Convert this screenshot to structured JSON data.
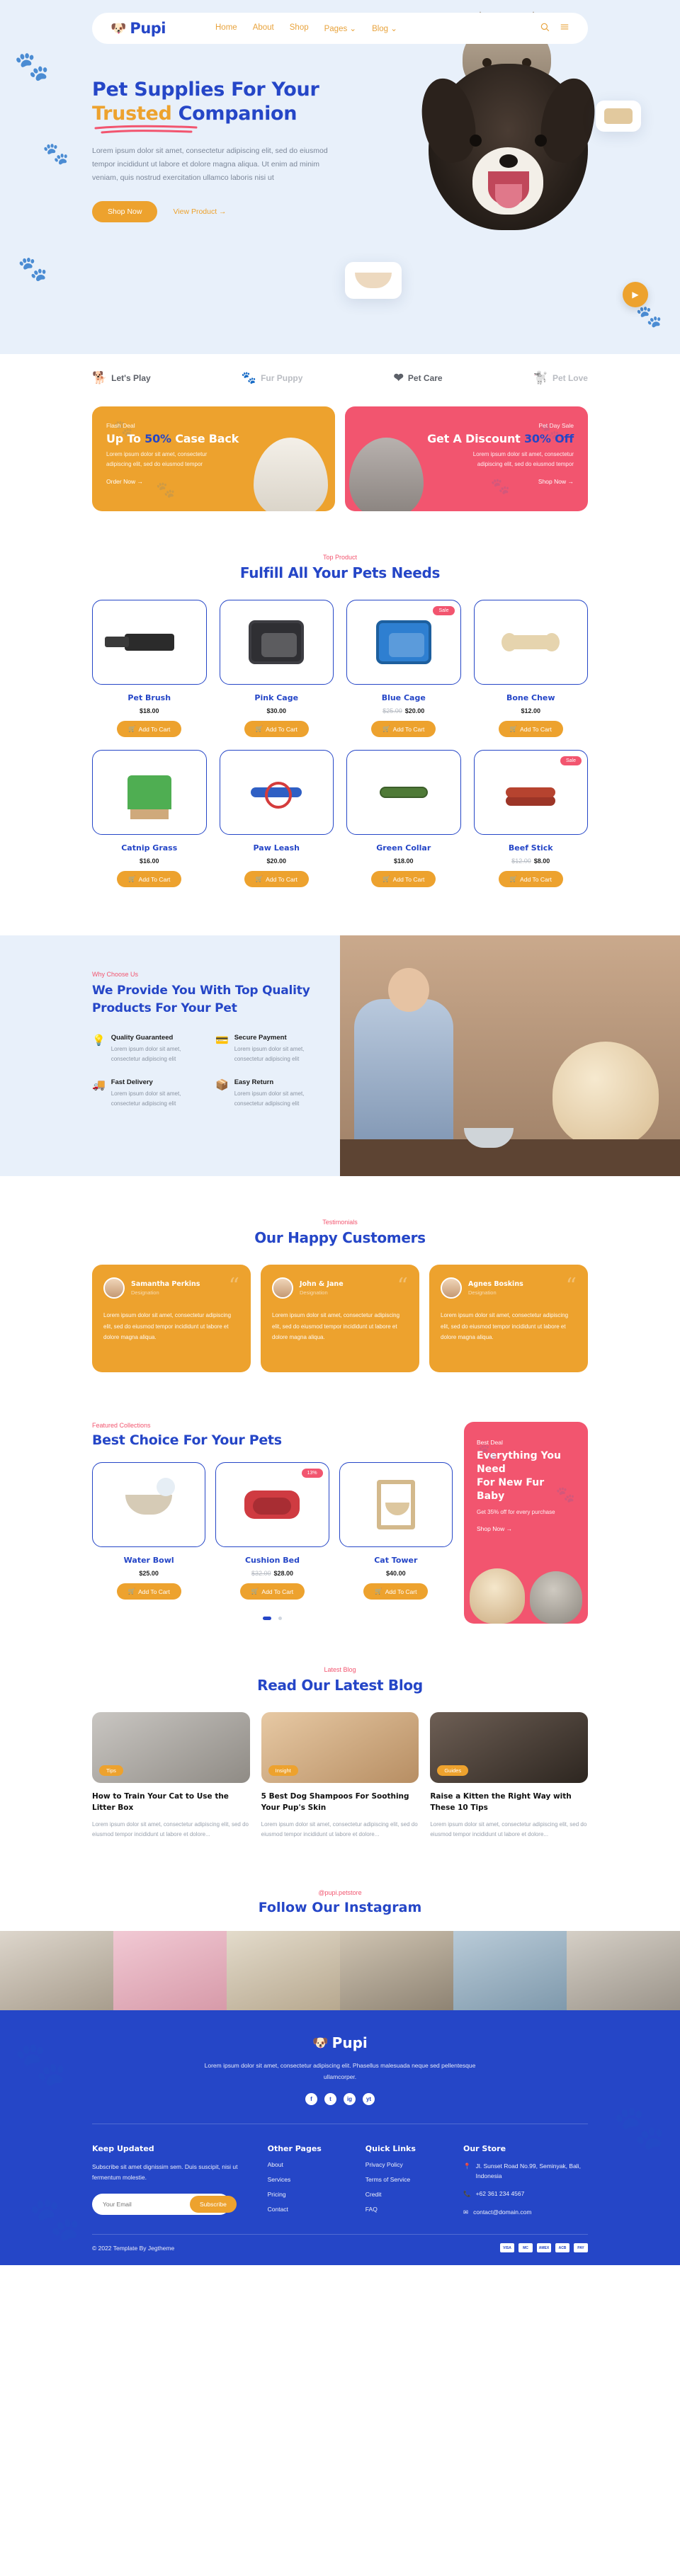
{
  "nav": {
    "logo_text": "Pupi",
    "logo_icon": "dog-face-icon",
    "links": [
      "Home",
      "About",
      "Shop",
      "Pages",
      "Blog"
    ],
    "search_icon": "search-icon",
    "menu_icon": "hamburger-menu-icon"
  },
  "hero": {
    "title_line1": "Pet Supplies For Your",
    "title_highlight": "Trusted",
    "title_rest": "Companion",
    "description": "Lorem ipsum dolor sit amet, consectetur adipiscing elit, sed do eiusmod tempor incididunt ut labore et dolore magna aliqua. Ut enim ad minim veniam, quis nostrud exercitation ullamco laboris nisi ut",
    "primary_button": "Shop Now",
    "secondary_link": "View Product →",
    "play_icon": "play-button-icon"
  },
  "brands": [
    {
      "label": "Let's Play",
      "icon": "dog-sketch-icon",
      "dark": true
    },
    {
      "label": "Fur Puppy",
      "icon": "paw-print-icon",
      "dark": false
    },
    {
      "label": "Pet Care",
      "icon": "heart-paw-icon",
      "dark": true
    },
    {
      "label": "Pet Love",
      "icon": "dog-heart-icon",
      "dark": false
    }
  ],
  "promos": [
    {
      "label": "Flash Deal",
      "title_pre": "Up To ",
      "title_hl": "50%",
      "title_post": " Case Back",
      "text": "Lorem ipsum dolor sit amet, consectetur adipiscing elit, sed do eiusmod tempor",
      "link": "Order Now →",
      "color": "#eda22e"
    },
    {
      "label": "Pet Day Sale",
      "title_pre": "Get A Discount ",
      "title_hl": "30% Off",
      "title_post": "",
      "text": "Lorem ipsum dolor sit amet, consectetur adipiscing elit, sed do eiusmod tempor",
      "link": "Shop Now →",
      "color": "#f2556f"
    }
  ],
  "products_section": {
    "eyebrow": "Top Product",
    "title": "Fulfill All Your Pets Needs",
    "cart_label": "Add To Cart",
    "cart_icon": "shopping-cart-icon",
    "items": [
      {
        "name": "Pet Brush",
        "price": "$18.00",
        "old_price": "",
        "badge": "",
        "art": "a-brush"
      },
      {
        "name": "Pink Cage",
        "price": "$30.00",
        "old_price": "",
        "badge": "",
        "art": "a-cage"
      },
      {
        "name": "Blue Cage",
        "price": "$20.00",
        "old_price": "$25.00",
        "badge": "Sale",
        "art": "a-cage blue"
      },
      {
        "name": "Bone Chew",
        "price": "$12.00",
        "old_price": "",
        "badge": "",
        "art": "a-bone"
      },
      {
        "name": "Catnip Grass",
        "price": "$16.00",
        "old_price": "",
        "badge": "",
        "art": "a-grass"
      },
      {
        "name": "Paw Leash",
        "price": "$20.00",
        "old_price": "",
        "badge": "",
        "art": "a-leash"
      },
      {
        "name": "Green Collar",
        "price": "$18.00",
        "old_price": "",
        "badge": "",
        "art": "a-collar"
      },
      {
        "name": "Beef Stick",
        "price": "$8.00",
        "old_price": "$12.00",
        "badge": "Sale",
        "art": "a-stick"
      }
    ]
  },
  "why": {
    "eyebrow": "Why Choose Us",
    "title_line1": "We Provide You With Top Quality",
    "title_line2": "Products For Your Pet",
    "items": [
      {
        "heading": "Quality Guaranteed",
        "text": "Lorem ipsum dolor sit amet, consectetur adipiscing elit",
        "icon": "lightbulb-icon"
      },
      {
        "heading": "Secure Payment",
        "text": "Lorem ipsum dolor sit amet, consectetur adipiscing elit",
        "icon": "credit-card-icon"
      },
      {
        "heading": "Fast Delivery",
        "text": "Lorem ipsum dolor sit amet, consectetur adipiscing elit",
        "icon": "truck-icon"
      },
      {
        "heading": "Easy Return",
        "text": "Lorem ipsum dolor sit amet, consectetur adipiscing elit",
        "icon": "return-box-icon"
      }
    ]
  },
  "testimonials": {
    "eyebrow": "Testimonials",
    "title": "Our Happy Customers",
    "items": [
      {
        "name": "Samantha Perkins",
        "role": "Designation",
        "text": "Lorem ipsum dolor sit amet, consectetur adipiscing elit, sed do eiusmod tempor incididunt ut labore et dolore magna aliqua."
      },
      {
        "name": "John & Jane",
        "role": "Designation",
        "text": "Lorem ipsum dolor sit amet, consectetur adipiscing elit, sed do eiusmod tempor incididunt ut labore et dolore magna aliqua."
      },
      {
        "name": "Agnes Boskins",
        "role": "Designation",
        "text": "Lorem ipsum dolor sit amet, consectetur adipiscing elit, sed do eiusmod tempor incididunt ut labore et dolore magna aliqua."
      }
    ]
  },
  "best": {
    "eyebrow": "Featured Collections",
    "title": "Best Choice For Your Pets",
    "cart_label": "Add To Cart",
    "items": [
      {
        "name": "Water Bowl",
        "price": "$25.00",
        "old_price": "",
        "badge": "",
        "art": "a-bowl"
      },
      {
        "name": "Cushion Bed",
        "price": "$28.00",
        "old_price": "$32.00",
        "badge": "13%",
        "art": "a-bed"
      },
      {
        "name": "Cat Tower",
        "price": "$40.00",
        "old_price": "",
        "badge": "",
        "art": "a-tower"
      }
    ],
    "deal": {
      "label": "Best Deal",
      "title_line1": "Everything You Need",
      "title_line2": "For New Fur Baby",
      "subtitle": "Get 35% off for every purchase",
      "link": "Shop Now →"
    }
  },
  "blog": {
    "eyebrow": "Latest Blog",
    "title": "Read Our Latest Blog",
    "posts": [
      {
        "tag": "Tips",
        "title": "How to Train Your Cat to Use the Litter Box",
        "excerpt": "Lorem ipsum dolor sit amet, consectetur adipiscing elit, sed do eiusmod tempor incididunt ut labore et dolore..."
      },
      {
        "tag": "Insight",
        "title": "5 Best Dog Shampoos For Soothing Your Pup's Skin",
        "excerpt": "Lorem ipsum dolor sit amet, consectetur adipiscing elit, sed do eiusmod tempor incididunt ut labore et dolore..."
      },
      {
        "tag": "Guides",
        "title": "Raise a Kitten the Right Way with These 10 Tips",
        "excerpt": "Lorem ipsum dolor sit amet, consectetur adipiscing elit, sed do eiusmod tempor incididunt ut labore et dolore..."
      }
    ]
  },
  "instagram": {
    "eyebrow": "@pupi.petstore",
    "title": "Follow Our Instagram"
  },
  "footer": {
    "logo_text": "Pupi",
    "description": "Lorem ipsum dolor sit amet, consectetur adipiscing elit. Phasellus malesuada neque sed pellentesque ullamcorper.",
    "social": [
      "f",
      "t",
      "ig",
      "yt"
    ],
    "subscribe": {
      "heading": "Keep Updated",
      "text": "Subscribe sit amet dignissim sem. Duis suscipit, nisi ut fermentum molestie.",
      "placeholder": "Your Email",
      "value": "",
      "button": "Subscribe"
    },
    "other_pages": {
      "heading": "Other Pages",
      "links": [
        "About",
        "Services",
        "Pricing",
        "Contact"
      ]
    },
    "quick_links": {
      "heading": "Quick Links",
      "links": [
        "Privacy Policy",
        "Terms of Service",
        "Credit",
        "FAQ"
      ]
    },
    "store": {
      "heading": "Our Store",
      "address": "Jl. Sunset Road No.99, Seminyak, Bali, Indonesia",
      "phone": "+62 361 234 4567",
      "email": "contact@domain.com"
    },
    "copyright": "© 2022 Template By Jegtheme",
    "payments": [
      "VISA",
      "MC",
      "AMEX",
      "ACB",
      "PAY"
    ]
  }
}
